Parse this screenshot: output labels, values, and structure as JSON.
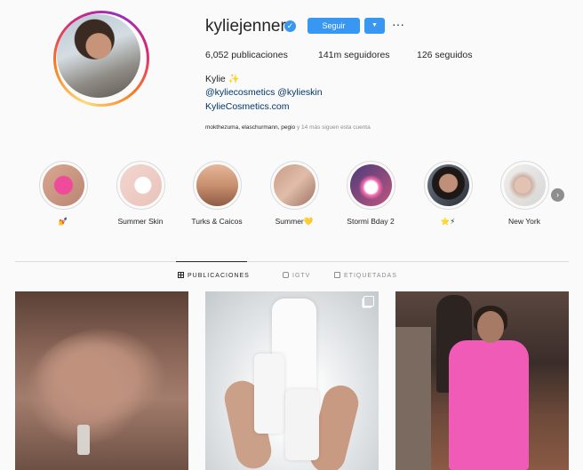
{
  "profile": {
    "username": "kyliejenner",
    "follow_label": "Seguir",
    "stats": {
      "posts": "6,052 publicaciones",
      "followers": "141m seguidores",
      "following": "126 seguidos"
    },
    "full_name": "Kylie ✨",
    "bio_mentions": "@kyliecosmetics @kylieskin",
    "website": "KylieCosmetics.com",
    "followed_by_names": "mokthezuma, elaschurmann, pegio",
    "followed_by_rest": " y 14 más siguen esta cuenta"
  },
  "highlights": [
    {
      "label": "💅"
    },
    {
      "label": "Summer Skin"
    },
    {
      "label": "Turks & Caicos"
    },
    {
      "label": "Summer💛"
    },
    {
      "label": "Stormi Bday 2"
    },
    {
      "label": "⭐⚡"
    },
    {
      "label": "New York"
    }
  ],
  "tabs": [
    {
      "label": "PUBLICACIONES"
    },
    {
      "label": "IGTV"
    },
    {
      "label": "ETIQUETADAS"
    }
  ],
  "colors": {
    "accent": "#3897f0",
    "link": "#003569",
    "suit": "#ef5bb6"
  },
  "icons": [
    "verified-badge-icon",
    "chevron-down-icon",
    "more-icon",
    "next-arrow-icon",
    "grid-icon",
    "igtv-icon",
    "tagged-icon",
    "multi-photo-icon"
  ]
}
